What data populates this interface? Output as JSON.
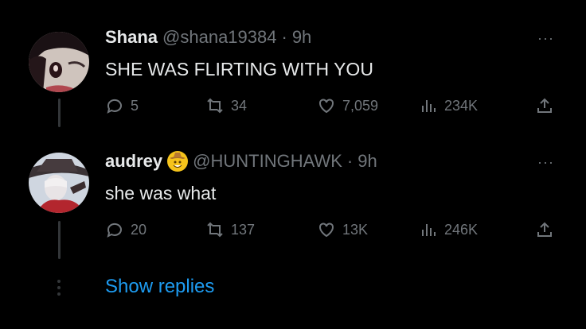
{
  "tweets": [
    {
      "name": "Shana",
      "handle": "@shana19384",
      "separator": "·",
      "time": "9h",
      "text": "SHE WAS FLIRTING WITH YOU",
      "replies": "5",
      "retweets": "34",
      "likes": "7,059",
      "views": "234K",
      "more": "···"
    },
    {
      "name": "audrey",
      "badge_icon": "cowboy-emoji-icon",
      "handle": "@HUNTINGHAWK",
      "separator": "·",
      "time": "9h",
      "text": "she was what",
      "replies": "20",
      "retweets": "137",
      "likes": "13K",
      "views": "246K",
      "more": "···"
    }
  ],
  "show_replies": "Show replies",
  "colors": {
    "background": "#000000",
    "text": "#e7e9ea",
    "muted": "#71767b",
    "link": "#1d9bf0"
  }
}
